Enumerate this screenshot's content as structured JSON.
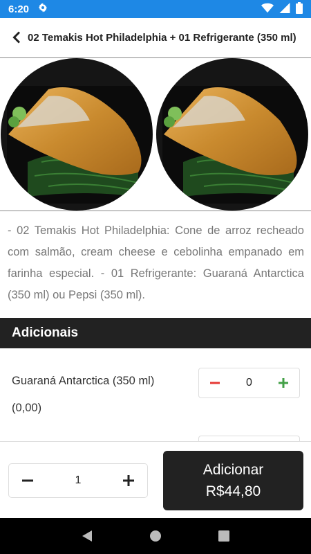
{
  "status_bar": {
    "time": "6:20"
  },
  "header": {
    "title": "02 Temakis Hot Philadelphia + 01 Refrigerante (350 ml)"
  },
  "product": {
    "description": "- 02 Temakis Hot Philadelphia: Cone de arroz recheado com salmão, cream cheese e cebolinha empanado em farinha especial. - 01 Refrigerante: Guaraná Antarctica (350 ml) ou Pepsi (350 ml)."
  },
  "addons": {
    "title": "Adicionais",
    "items": [
      {
        "name": "Guaraná Antarctica (350 ml)",
        "price": "(0,00)",
        "quantity": "0"
      }
    ]
  },
  "bottom": {
    "quantity": "1",
    "add_label": "Adicionar",
    "total": "R$44,80"
  },
  "colors": {
    "status_bar": "#1e88e5",
    "dark": "#222222",
    "minus": "#e53935",
    "plus": "#43a047"
  }
}
